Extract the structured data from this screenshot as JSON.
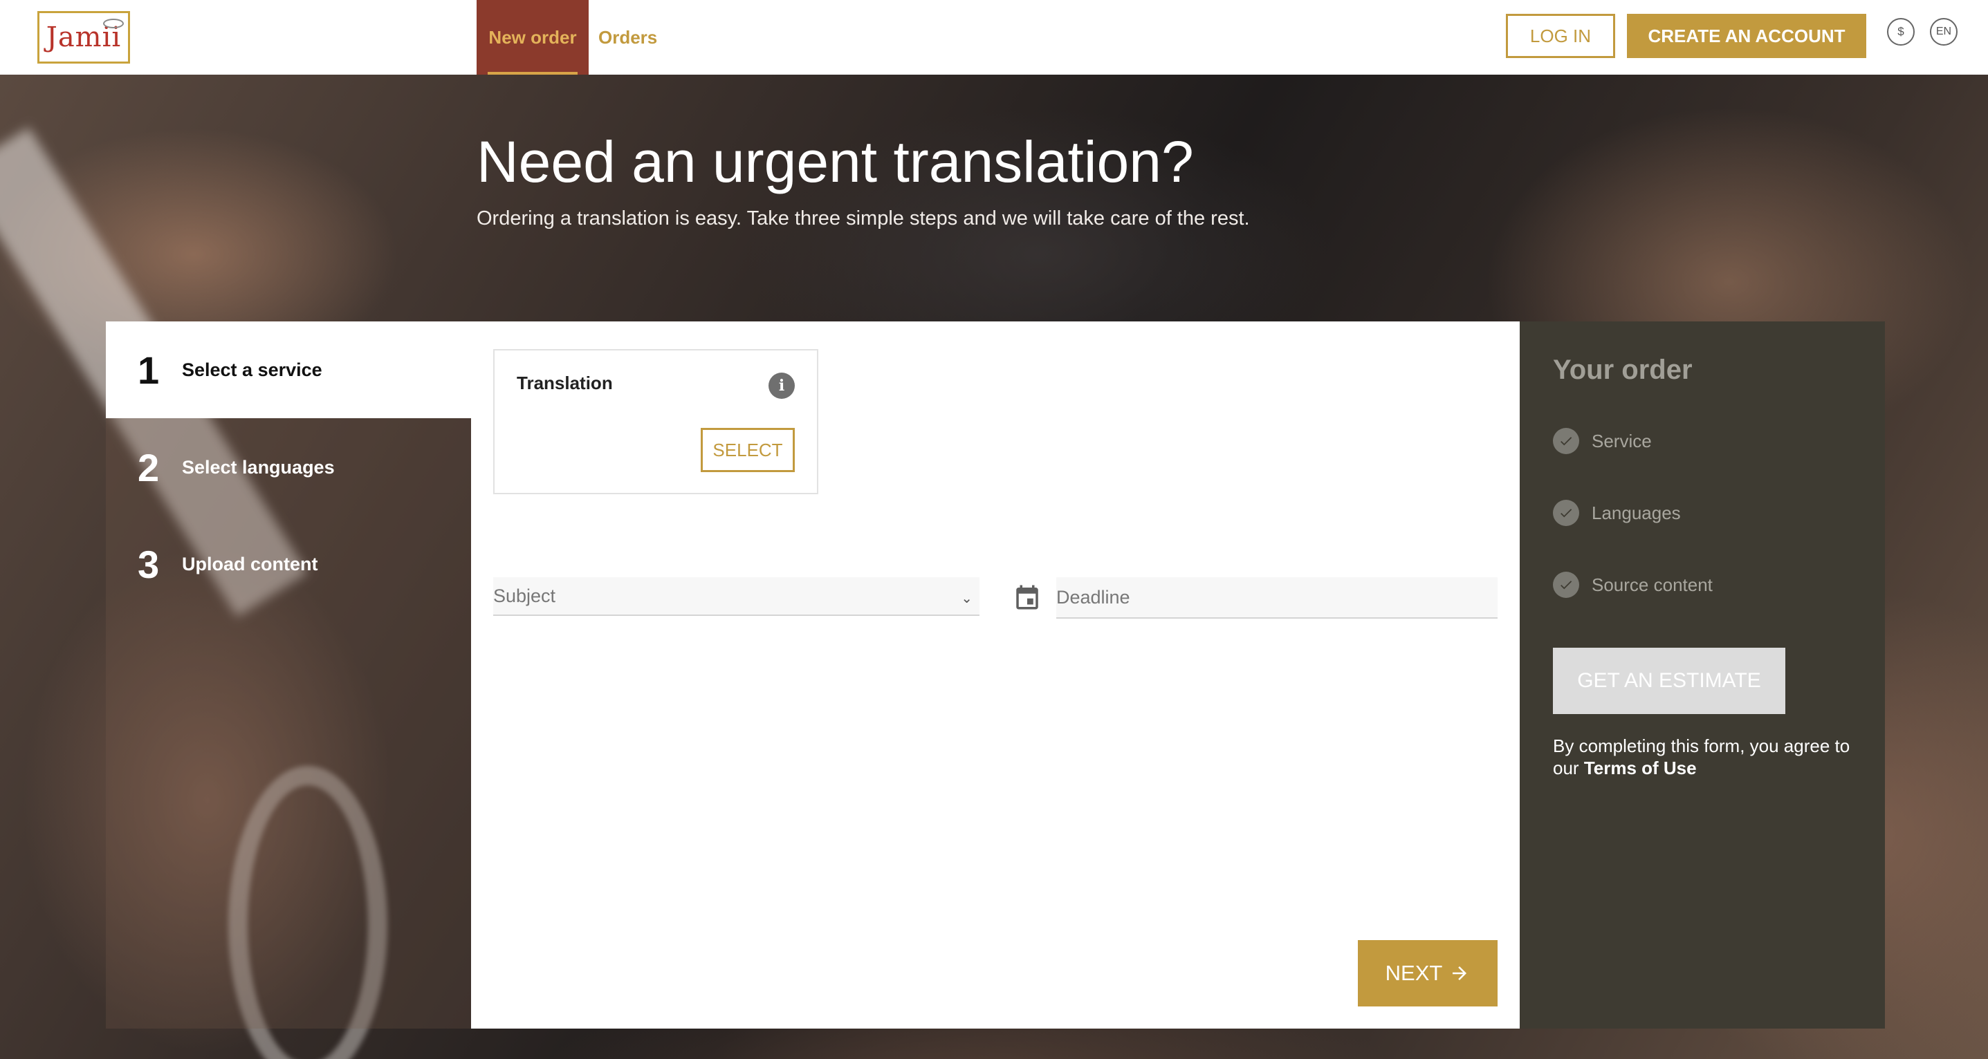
{
  "header": {
    "logo_text": "Jamii",
    "nav": [
      {
        "label": "New order",
        "active": true
      },
      {
        "label": "Orders",
        "active": false
      }
    ],
    "login_label": "LOG IN",
    "create_account_label": "CREATE AN ACCOUNT",
    "currency_symbol": "$",
    "language_code": "EN"
  },
  "hero": {
    "title": "Need an urgent translation?",
    "subtitle": "Ordering a translation is easy. Take three simple steps and we will take care of the rest."
  },
  "steps": [
    {
      "number": "1",
      "label": "Select a service",
      "active": true
    },
    {
      "number": "2",
      "label": "Select languages",
      "active": false
    },
    {
      "number": "3",
      "label": "Upload content",
      "active": false
    }
  ],
  "service": {
    "title": "Translation",
    "select_label": "SELECT"
  },
  "form": {
    "subject_placeholder": "Subject",
    "deadline_placeholder": "Deadline"
  },
  "next_label": "NEXT",
  "order": {
    "title": "Your order",
    "items": [
      "Service",
      "Languages",
      "Source content"
    ],
    "estimate_label": "GET AN ESTIMATE",
    "agree_text": "By completing this form, you agree to our ",
    "terms_label": "Terms of Use"
  },
  "colors": {
    "accent": "#c29a3e",
    "active_tab": "#8b3a2c",
    "summary_bg": "#3e3b32"
  }
}
